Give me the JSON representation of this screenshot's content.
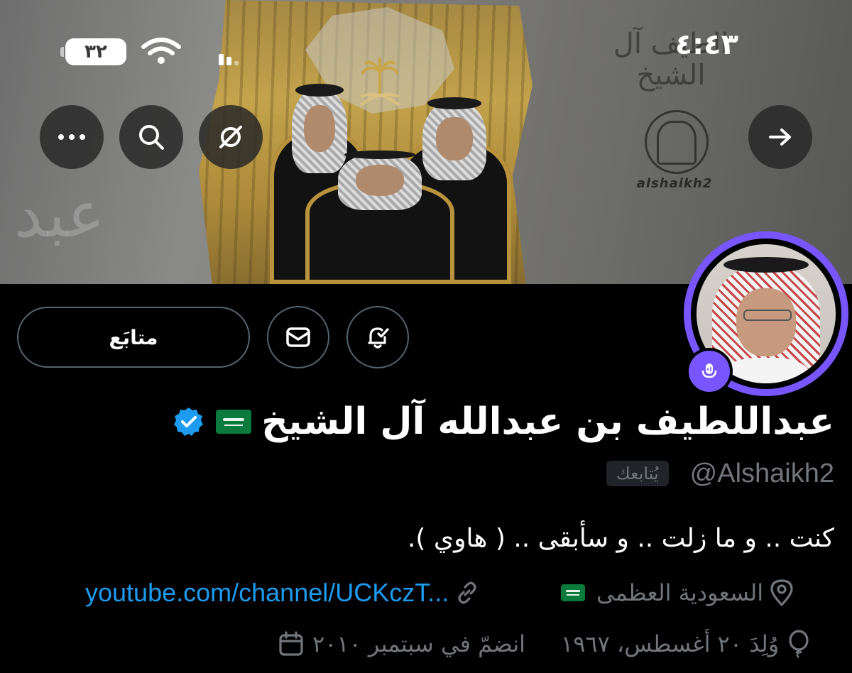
{
  "status_bar": {
    "time": "٤:٤٣",
    "battery": "٣٢"
  },
  "banner": {
    "calligraphy": "الطيف آل الشيخ",
    "watermark_handle": "alshaikh2",
    "background_script": "عبد"
  },
  "header_actions": {
    "back_icon": "arrow-right-icon",
    "more_icon": "ellipsis-icon",
    "search_icon": "search-icon",
    "grok_icon": "grok-icon"
  },
  "actions": {
    "follow_label": "متابَع",
    "message_icon": "envelope-icon",
    "notify_icon": "bell-check-icon"
  },
  "profile": {
    "display_name": "عبداللطيف بن عبدالله آل الشيخ",
    "verified": true,
    "handle": "@Alshaikh2",
    "follows_you": "يُتابعك",
    "bio": "كنت .. و ما زلت .. و سأبقى .. ( هاوي ).",
    "location": "السعودية العظمى",
    "link": "youtube.com/channel/UCKczT...",
    "birthday": "وُلِدَ ٢٠ أغسطس، ١٩٦٧",
    "joined": "انضمّ في سبتمبر ٢٠١٠"
  },
  "colors": {
    "accent": "#1d9bf0",
    "spaces_ring": "#7856ff",
    "flag_green": "#0a7a3d",
    "muted": "#71767b",
    "border": "#536471"
  }
}
